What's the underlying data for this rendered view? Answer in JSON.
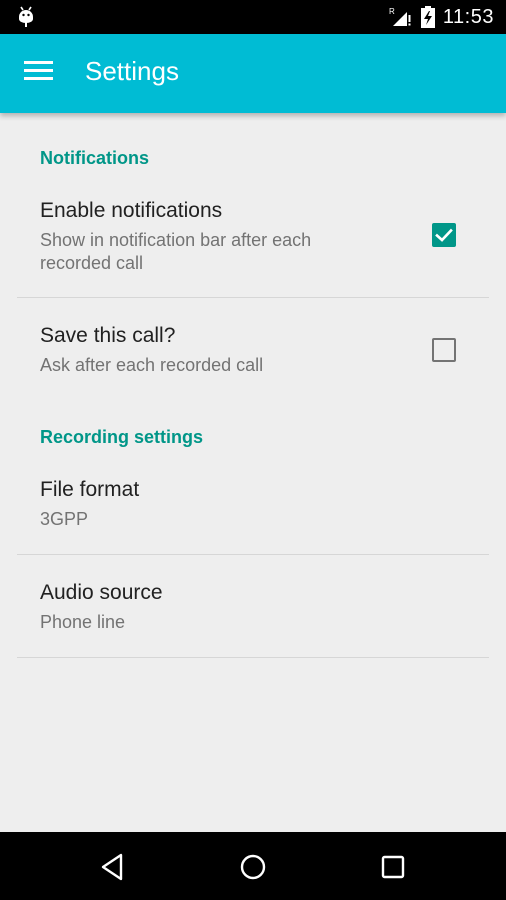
{
  "status_bar": {
    "time": "11:53",
    "signal_label": "R",
    "icons": [
      "android-debug-icon",
      "signal-roaming-icon",
      "battery-charging-icon"
    ]
  },
  "app_bar": {
    "title": "Settings",
    "menu_icon": "hamburger-menu-icon"
  },
  "sections": [
    {
      "header": "Notifications",
      "items": [
        {
          "title": "Enable notifications",
          "summary": "Show in notification bar after each recorded call",
          "checked": true
        },
        {
          "title": "Save this call?",
          "summary": "Ask after each recorded call",
          "checked": false
        }
      ]
    },
    {
      "header": "Recording settings",
      "items": [
        {
          "title": "File format",
          "summary": "3GPP"
        },
        {
          "title": "Audio source",
          "summary": "Phone line"
        }
      ]
    }
  ],
  "colors": {
    "app_bar": "#00bcd4",
    "accent": "#009688",
    "background": "#eeeeee"
  },
  "nav_bar": {
    "buttons": [
      "back-icon",
      "home-icon",
      "recents-icon"
    ]
  }
}
